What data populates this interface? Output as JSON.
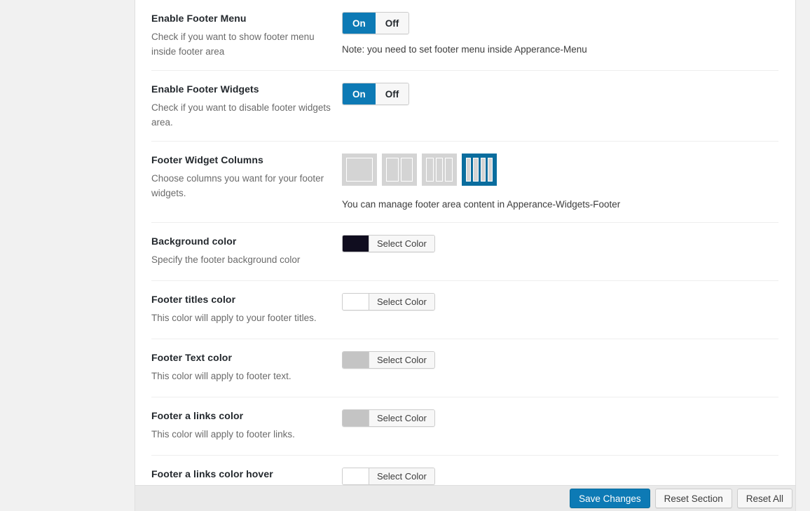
{
  "theme": {
    "accent_blue": "#0d7ab5",
    "accent_blue_dark": "#0a6d9e",
    "panel_bg": "#ffffff",
    "page_bg": "#f1f1f1",
    "bottombar_bg": "#eaeaea",
    "divider": "#eeeeee"
  },
  "rows": [
    {
      "id": "enable-footer-menu",
      "title": "Enable Footer Menu",
      "desc": "Check if you want to show footer menu inside footer area",
      "type": "toggle",
      "toggle": {
        "on_label": "On",
        "off_label": "Off",
        "value": "On"
      },
      "note": "Note: you need to set footer menu inside Apperance-Menu"
    },
    {
      "id": "enable-footer-widgets",
      "title": "Enable Footer Widgets",
      "desc": "Check if you want to disable footer widgets area.",
      "type": "toggle",
      "toggle": {
        "on_label": "On",
        "off_label": "Off",
        "value": "On"
      },
      "note": ""
    },
    {
      "id": "footer-widget-columns",
      "title": "Footer Widget Columns",
      "desc": "Choose columns you want for your footer widgets.",
      "type": "columns",
      "columns": {
        "options": [
          1,
          2,
          3,
          4
        ],
        "selected": 4
      },
      "hint": "You can manage footer area content in Apperance-Widgets-Footer"
    },
    {
      "id": "background-color",
      "title": "Background color",
      "desc": "Specify the footer background color",
      "type": "color",
      "color": {
        "button_label": "Select Color",
        "value": "#100d1f"
      }
    },
    {
      "id": "footer-titles-color",
      "title": "Footer titles color",
      "desc": "This color will apply to your footer titles.",
      "type": "color",
      "color": {
        "button_label": "Select Color",
        "value": "#ffffff"
      }
    },
    {
      "id": "footer-text-color",
      "title": "Footer Text color",
      "desc": "This color will apply to footer text.",
      "type": "color",
      "color": {
        "button_label": "Select Color",
        "value": "#c4c4c4"
      }
    },
    {
      "id": "footer-a-links-color",
      "title": "Footer a links color",
      "desc": "This color will apply to footer links.",
      "type": "color",
      "color": {
        "button_label": "Select Color",
        "value": "#c4c4c4"
      }
    },
    {
      "id": "footer-a-links-color-hover",
      "title": "Footer a links color hover",
      "desc": "",
      "type": "color",
      "color": {
        "button_label": "Select Color",
        "value": "#ffffff"
      }
    }
  ],
  "bottombar": {
    "save_label": "Save Changes",
    "reset_section_label": "Reset Section",
    "reset_all_label": "Reset All"
  }
}
